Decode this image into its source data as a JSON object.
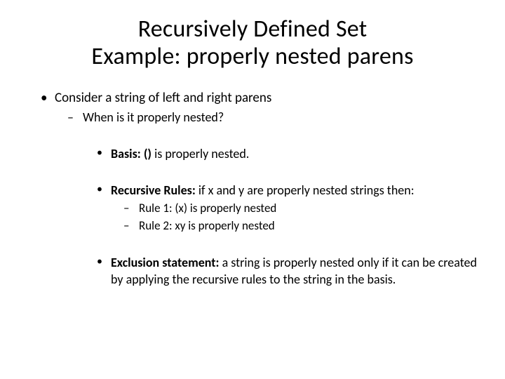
{
  "title_line1": "Recursively Defined Set",
  "title_line2": "Example: properly nested parens",
  "l1_item": "Consider a string of left and right parens",
  "l2_item": "When is it properly nested?",
  "basis_label": "Basis:",
  "basis_parens": "()",
  "basis_rest": " is properly nested.",
  "rr_label": "Recursive Rules:",
  "rr_rest": " if x and y are properly nested strings then:",
  "rr_rule1": "Rule 1:  (x) is properly nested",
  "rr_rule2": "Rule 2:   xy is properly nested",
  "excl_label": "Exclusion statement:",
  "excl_rest": " a string is properly nested only if it can be created by applying the recursive rules to the string in the basis."
}
